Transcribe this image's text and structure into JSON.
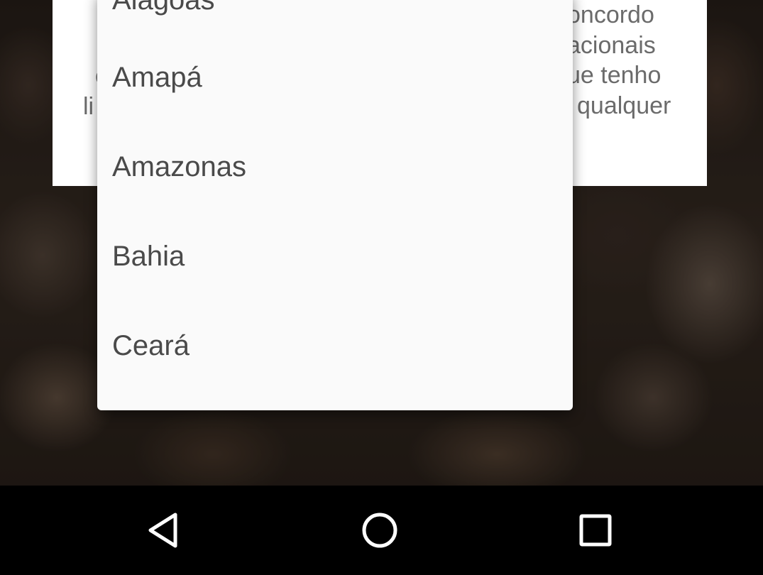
{
  "background_card": {
    "right_lines": [
      "oncordo",
      "acionais",
      "ue tenho",
      "qualquer"
    ],
    "left_lines": [
      "c",
      "li"
    ]
  },
  "dropdown": {
    "items": [
      {
        "label": "Alagoas"
      },
      {
        "label": "Amapá"
      },
      {
        "label": "Amazonas"
      },
      {
        "label": "Bahia"
      },
      {
        "label": "Ceará"
      }
    ]
  },
  "navbar": {
    "back_icon": "back-triangle-icon",
    "home_icon": "home-circle-icon",
    "recents_icon": "recents-square-icon",
    "icon_color": "#ffffff"
  }
}
